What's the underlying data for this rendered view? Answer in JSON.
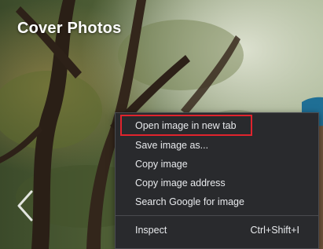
{
  "gallery": {
    "title": "Cover Photos",
    "prev_icon": "chevron-left-icon"
  },
  "context_menu": {
    "items": [
      {
        "label": "Open image in new tab"
      },
      {
        "label": "Save image as..."
      },
      {
        "label": "Copy image"
      },
      {
        "label": "Copy image address"
      },
      {
        "label": "Search Google for image"
      }
    ],
    "inspect": {
      "label": "Inspect",
      "shortcut": "Ctrl+Shift+I"
    }
  },
  "colors": {
    "menu_bg": "#292a2d",
    "menu_text": "#e8eaed",
    "highlight": "#e0242d"
  }
}
